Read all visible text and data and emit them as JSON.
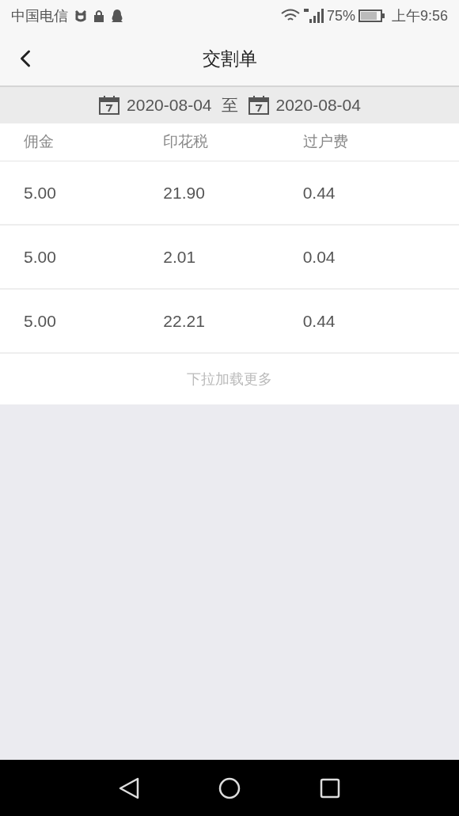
{
  "status_bar": {
    "carrier": "中国电信",
    "battery_percent": "75%",
    "time": "上午9:56"
  },
  "header": {
    "title": "交割单"
  },
  "date_range": {
    "start": "2020-08-04",
    "separator": "至",
    "end": "2020-08-04"
  },
  "table": {
    "columns": [
      "佣金",
      "印花税",
      "过户费"
    ],
    "rows": [
      [
        "5.00",
        "21.90",
        "0.44"
      ],
      [
        "5.00",
        "2.01",
        "0.04"
      ],
      [
        "5.00",
        "22.21",
        "0.44"
      ]
    ]
  },
  "load_more": "下拉加载更多"
}
